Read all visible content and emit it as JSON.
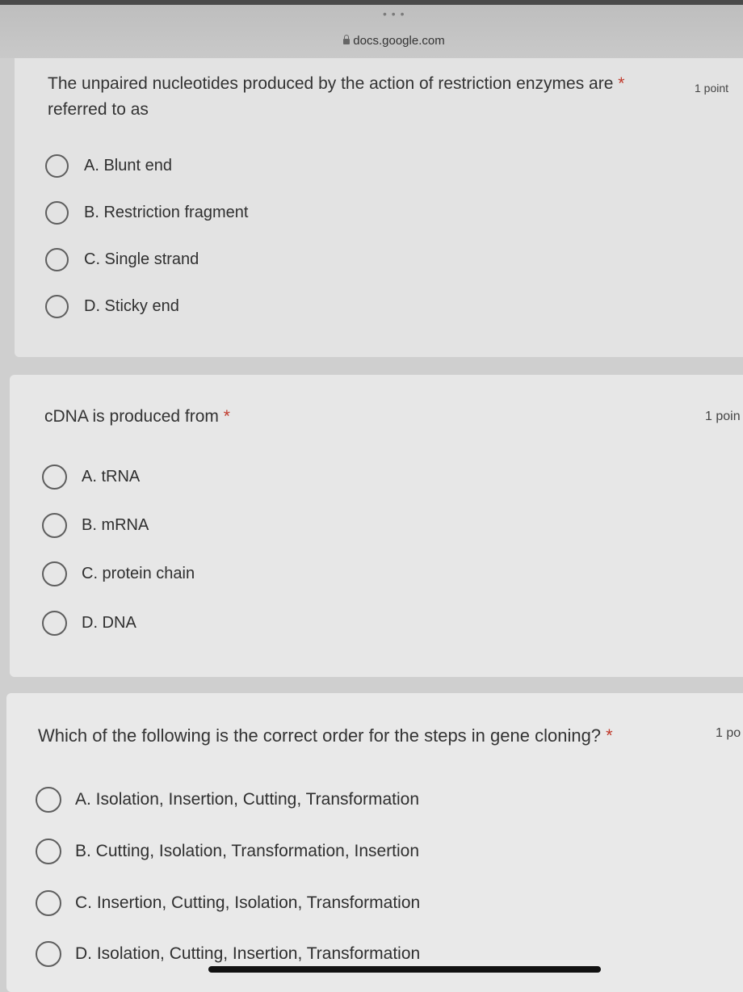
{
  "browser": {
    "url": "docs.google.com"
  },
  "questions": [
    {
      "title_line1": "The unpaired nucleotides produced by the action of restriction enzymes are",
      "title_line2": "referred to as",
      "required_mark": "*",
      "points": "1 point",
      "options": [
        "A. Blunt end",
        "B. Restriction fragment",
        "C. Single strand",
        "D. Sticky end"
      ]
    },
    {
      "title": "cDNA is produced from",
      "required_mark": "*",
      "points": "1 poin",
      "options": [
        "A. tRNA",
        "B. mRNA",
        "C. protein chain",
        "D. DNA"
      ]
    },
    {
      "title": "Which of the following is the correct order for the steps in gene cloning?",
      "required_mark": "*",
      "points": "1 po",
      "options": [
        "A. Isolation, Insertion, Cutting, Transformation",
        "B. Cutting, Isolation, Transformation, Insertion",
        "C. Insertion, Cutting, Isolation, Transformation",
        "D. Isolation, Cutting, Insertion, Transformation"
      ]
    }
  ],
  "colors": {
    "required_star": "#c0392b",
    "card_background": "#e7e7e7",
    "page_background": "#cfcfcf"
  }
}
